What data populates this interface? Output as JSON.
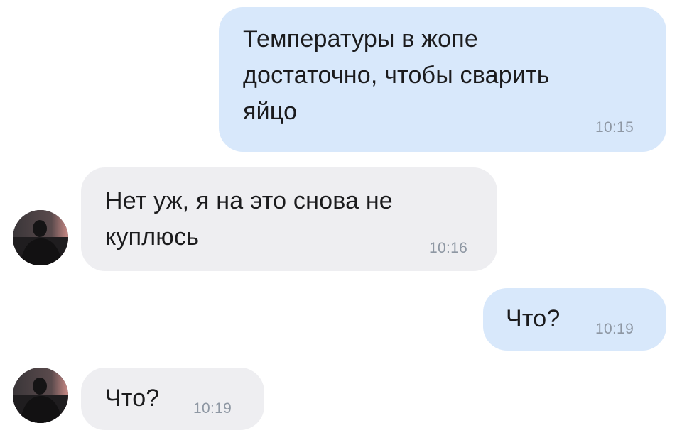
{
  "messages": [
    {
      "direction": "outgoing",
      "text": "Температуры в жопе\nдостаточно, чтобы сварить\nяйцо",
      "time": "10:15"
    },
    {
      "direction": "incoming",
      "text": "Нет уж, я на это снова не\nкуплюсь",
      "time": "10:16"
    },
    {
      "direction": "outgoing",
      "text": "Что?",
      "time": "10:19"
    },
    {
      "direction": "incoming",
      "text": "Что?",
      "time": "10:19"
    }
  ],
  "colors": {
    "outgoing_bubble": "#d8e8fb",
    "incoming_bubble": "#eeeef1",
    "text": "#1b1b1d",
    "timestamp": "#8e97a3"
  },
  "icons": {
    "avatar": "contact-photo-avatar"
  }
}
